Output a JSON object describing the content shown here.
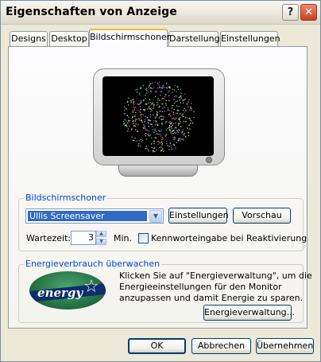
{
  "window": {
    "title": "Eigenschaften von Anzeige",
    "help_label": "?",
    "close_label": "✕"
  },
  "tabs": [
    {
      "label": "Designs",
      "active": false
    },
    {
      "label": "Desktop",
      "active": false
    },
    {
      "label": "Bildschirmschoner",
      "active": true
    },
    {
      "label": "Darstellung",
      "active": false
    },
    {
      "label": "Einstellungen",
      "active": false
    }
  ],
  "screensaver": {
    "group_label": "Bildschirmschoner",
    "selected": "Ullis Screensaver",
    "settings_button": "Einstellungen",
    "preview_button": "Vorschau",
    "wait_label": "Wartezeit:",
    "wait_value": "3",
    "wait_unit": "Min.",
    "password_label": "Kennworteingabe bei Reaktivierung",
    "password_checked": false
  },
  "energy": {
    "group_label": "Energieverbrauch überwachen",
    "logo_text": "energy",
    "description_lines": [
      "Klicken Sie auf \"Energieverwaltung\", um die",
      "Energieeinstellungen für den Monitor",
      "anzupassen und damit Energie zu sparen."
    ],
    "button": "Energieverwaltung..."
  },
  "footer": {
    "ok": "OK",
    "cancel": "Abbrechen",
    "apply": "Übernehmen"
  },
  "colors": {
    "accent_tab": "#ffb535",
    "group_label": "#0046d5",
    "selection": "#316ac5",
    "close_button": "#c9401d"
  }
}
